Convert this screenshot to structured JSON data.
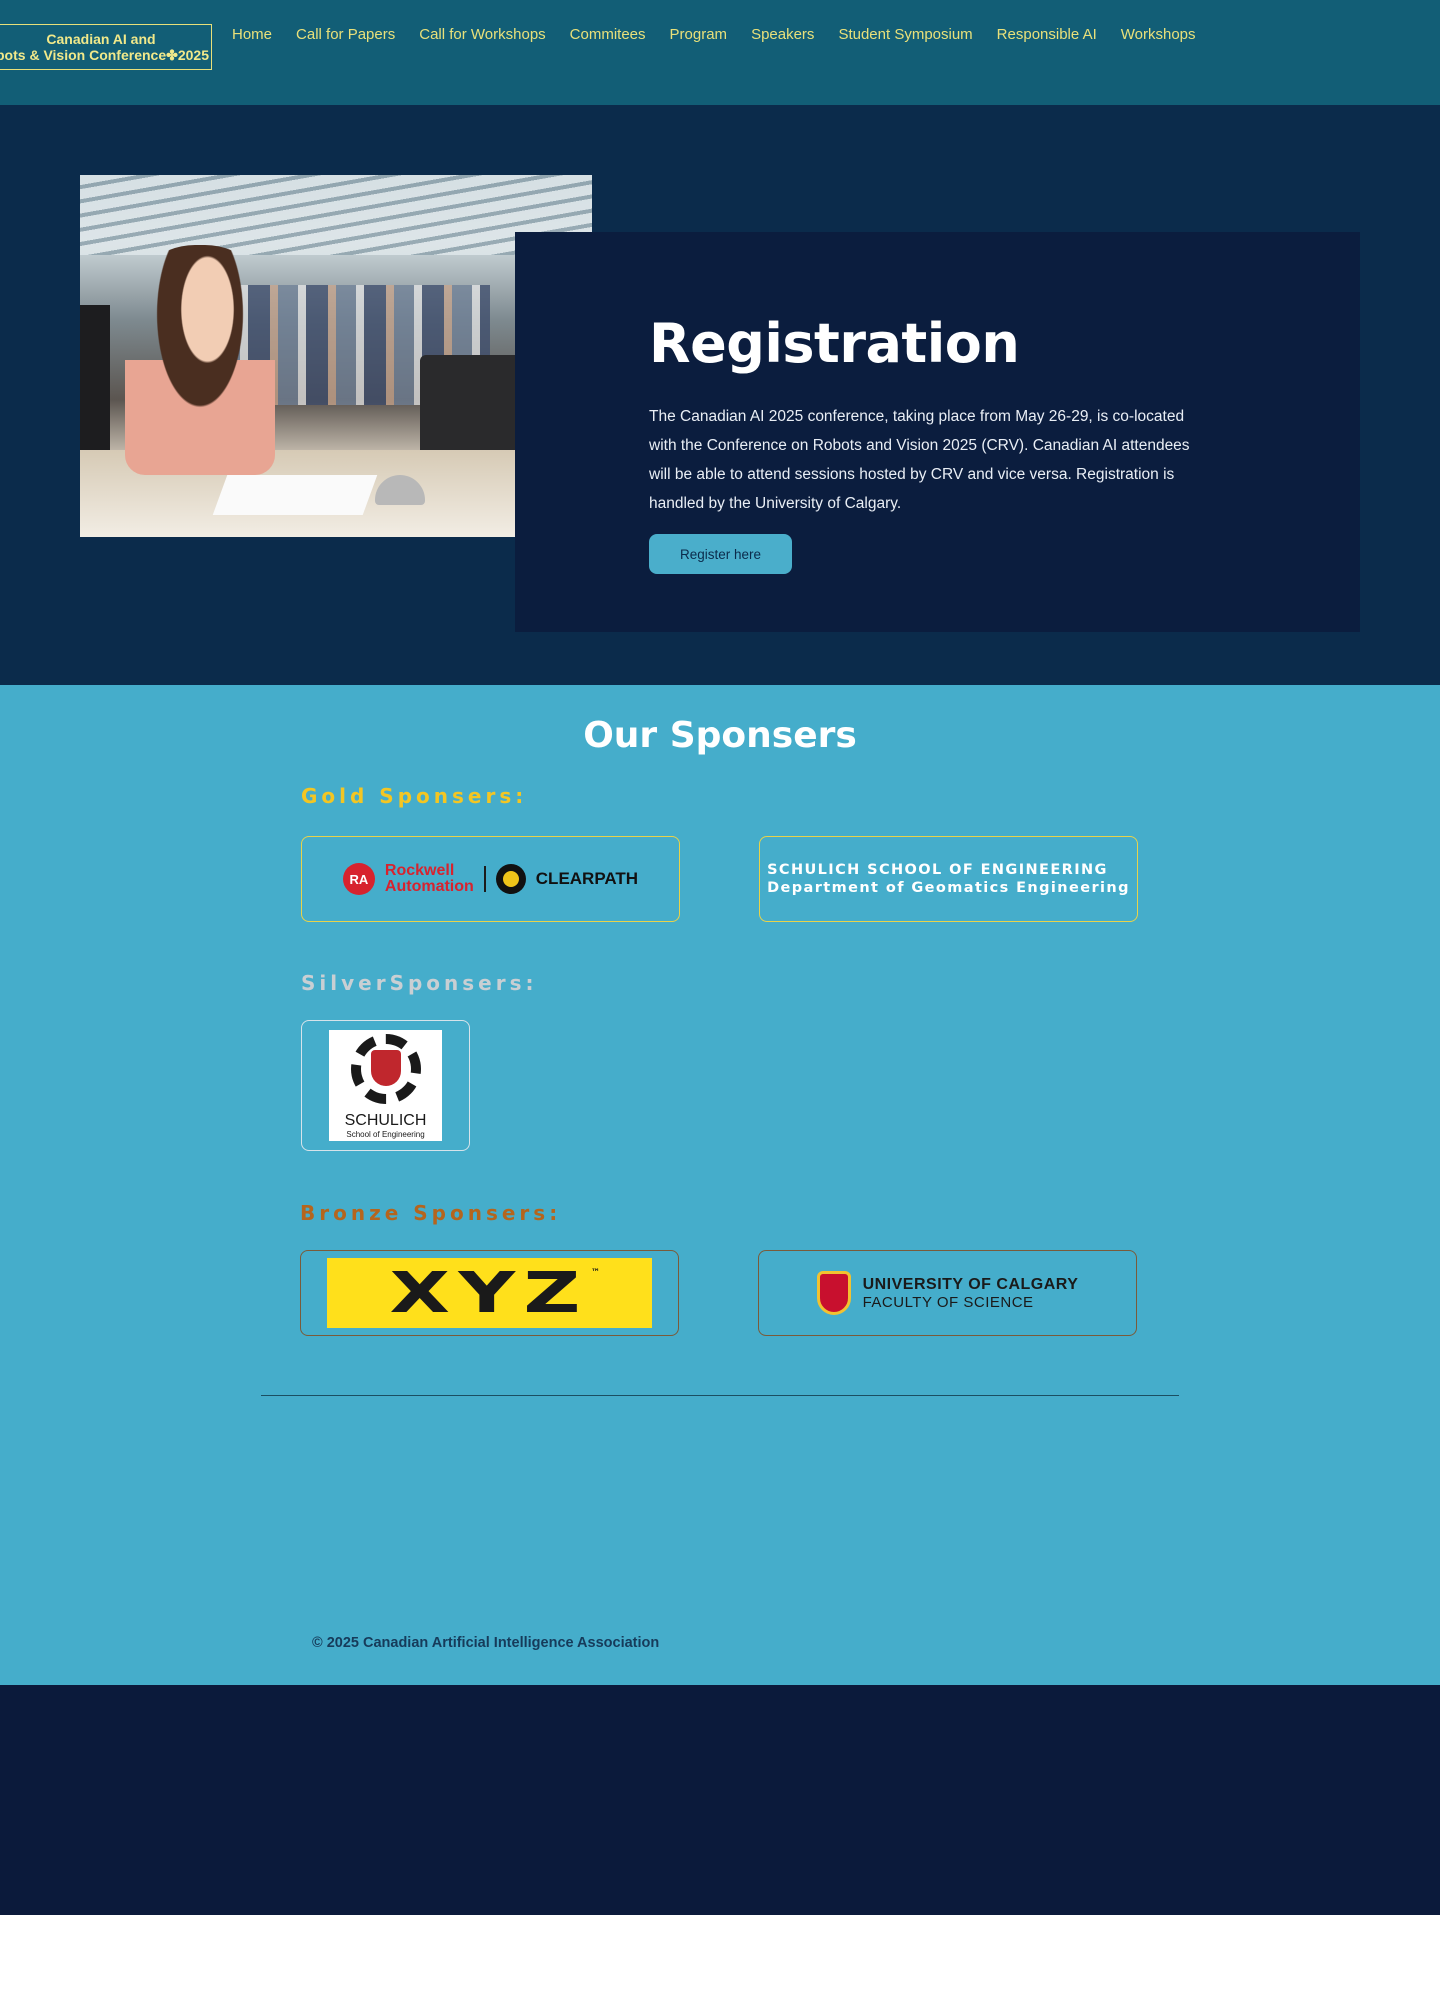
{
  "header": {
    "logo_line1": "Canadian AI and",
    "logo_line2": "bots & Vision Conference",
    "logo_year": "2025",
    "nav": [
      "Home",
      "Call for Papers",
      "Call for Workshops",
      "Commitees",
      "Program",
      "Speakers",
      "Student Symposium",
      "Responsible AI",
      "Workshops"
    ]
  },
  "registration": {
    "title": "Registration",
    "text": "The Canadian AI 2025 conference, taking place from May 26-29, is co-located with the Conference on Robots and Vision 2025 (CRV). Canadian AI attendees will be able to attend sessions hosted by CRV and vice versa. Registration is handled by the University of Calgary.",
    "button": "Register here"
  },
  "sponsors": {
    "title": "Our Sponsers",
    "gold_label": "Gold Sponsers:",
    "silver_label": "SilverSponsers:",
    "bronze_label": "Bronze Sponsers:",
    "gold": {
      "rockwell_mark": "RA",
      "rockwell_name_1": "Rockwell",
      "rockwell_name_2": "Automation",
      "clearpath": "CLEARPATH",
      "schulich_line1": "SCHULICH SCHOOL OF ENGINEERING",
      "schulich_line2": "Department of Geomatics Engineering"
    },
    "silver": {
      "name": "SCHULICH",
      "sub": "School of Engineering"
    },
    "bronze": {
      "xyz": "XYZ",
      "tm": "™",
      "ucal_line1": "UNIVERSITY OF CALGARY",
      "ucal_line2": "FACULTY OF SCIENCE"
    }
  },
  "footer": {
    "copyright": "© 2025 Canadian Artificial Intelligence Association"
  },
  "colors": {
    "header_bg": "#125e76",
    "nav_text": "#e8e07a",
    "section_bg": "#0b2b4b",
    "card_bg": "#0b1d3e",
    "accent": "#4aaecb",
    "sponsor_bg": "#45adcb",
    "gold": "#f3c623",
    "bronze": "#b5651d"
  },
  "icons": [
    "maple-leaf-icon",
    "gear-icon",
    "crest-icon",
    "hexagon-icon"
  ]
}
